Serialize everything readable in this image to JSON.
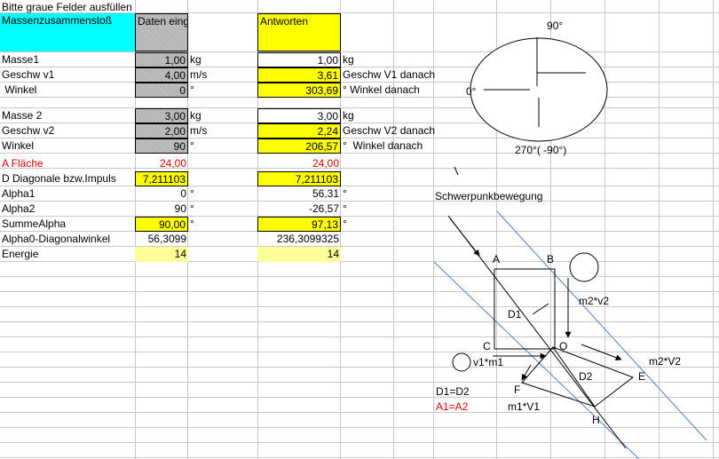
{
  "instruction": "Bitte graue Felder ausfüllen",
  "headers": {
    "title": "Massenzusammenstoß",
    "input": "Daten eingeben",
    "answers": "Antworten"
  },
  "rows": {
    "masse1": {
      "label": "Masse1",
      "input": "1,00",
      "unit_in": "kg",
      "answer": "1,00",
      "unit_out": "kg"
    },
    "v1": {
      "label": "Geschw v1",
      "input": "4,00",
      "unit_in": "m/s",
      "answer": "3,61",
      "unit_out": "Geschw V1 danach"
    },
    "winkel1": {
      "label": " Winkel",
      "input": "0",
      "unit_in": "°",
      "answer": "303,69",
      "unit_out": "° Winkel danach"
    },
    "masse2": {
      "label": "Masse 2",
      "input": "3,00",
      "unit_in": "kg",
      "answer": "3,00",
      "unit_out": "kg"
    },
    "v2": {
      "label": "Geschw v2",
      "input": "2,00",
      "unit_in": "m/s",
      "answer": "2,24",
      "unit_out": "Geschw V2 danach"
    },
    "winkel2": {
      "label": "Winkel",
      "input": "90",
      "unit_in": "°",
      "answer": "206,57",
      "unit_out": "°  Winkel danach"
    },
    "flaeche": {
      "label": "A Fläche",
      "input": "24,00",
      "answer": "24,00"
    },
    "diagonale": {
      "label": "D Diagonale bzw.Impuls",
      "input": "7,211103",
      "answer": "7,211103"
    },
    "alpha1": {
      "label": "Alpha1",
      "input": "0",
      "unit_in": "°",
      "answer": "56,31",
      "unit_out": "°"
    },
    "alpha2": {
      "label": "Alpha2",
      "input": "90",
      "unit_in": "°",
      "answer": "-26,57",
      "unit_out": "°"
    },
    "summe": {
      "label": "SummeAlpha",
      "input": "90,00",
      "unit_in": "°",
      "answer": "97,13",
      "unit_out": "°"
    },
    "alpha0": {
      "label": "Alpha0-Diagonalwinkel",
      "input": "56,3099",
      "answer": "236,3099325"
    },
    "energie": {
      "label": "Energie",
      "input": "14",
      "answer": "14"
    }
  },
  "compass": {
    "top": "90°",
    "left": "0°",
    "bottom": "270°( -90°)"
  },
  "diagram": {
    "title": "Schwerpunkbewegung",
    "slash": "/",
    "points": {
      "A": "A",
      "B": "B",
      "C": "C",
      "O": "O",
      "E": "E",
      "F": "F",
      "H": "H"
    },
    "labels": {
      "d1": "D1",
      "d2": "D2",
      "m2v2": "m2*v2",
      "m2V2": "m2*V2",
      "v1m1": "v1*m1",
      "m1V1": "m1*V1"
    },
    "eq_d": "D1=D2",
    "eq_a": "A1=A2"
  },
  "colors": {
    "input": "#c0c0c0",
    "answer": "#ffff00",
    "header": "#00ffff",
    "energy": "#ffff99",
    "red": "#e00000",
    "grid": "#c8c8c8",
    "blue_line": "#5080c0"
  }
}
